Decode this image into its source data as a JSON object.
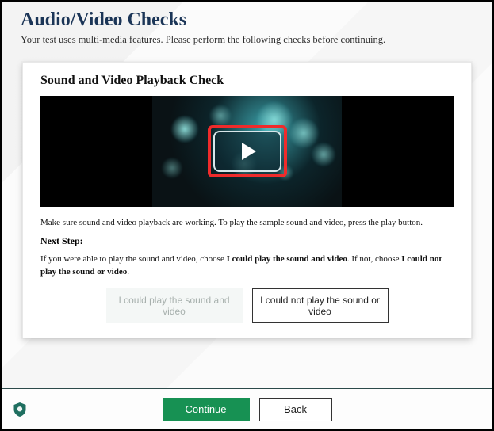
{
  "header": {
    "title": "Audio/Video Checks",
    "subtitle": "Your test uses multi-media features. Please perform the following checks before continuing."
  },
  "card": {
    "title": "Sound and Video Playback Check",
    "instruction": "Make sure sound and video playback are working. To play the sample sound and video, press the play button.",
    "next_step_label": "Next Step:",
    "next_step_prefix": "If you were able to play the sound and video, choose ",
    "next_step_opt1": "I could play the sound and video",
    "next_step_mid": ". If not, choose ",
    "next_step_opt2": "I could not play the sound or video",
    "next_step_suffix": ".",
    "choices": {
      "could_play": "I could play the sound and video",
      "could_not_play": "I could not play the sound or video"
    }
  },
  "footer": {
    "continue_label": "Continue",
    "back_label": "Back"
  }
}
